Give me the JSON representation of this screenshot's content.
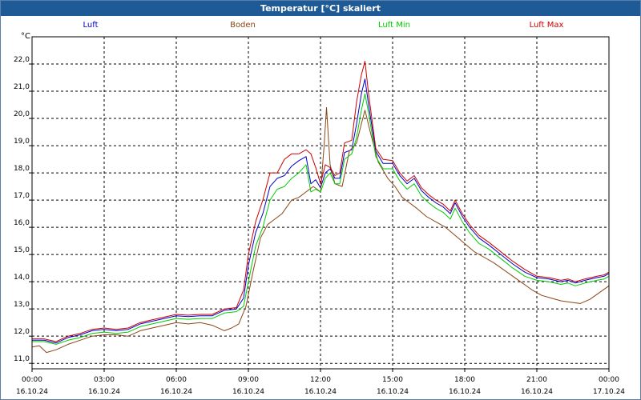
{
  "window": {
    "title": "Temperatur [°C] skaliert"
  },
  "chart_data": {
    "type": "line",
    "title": "Temperatur [°C] skaliert",
    "ylabel": "°C",
    "xlabel": "",
    "ylim": [
      10.8,
      23.0
    ],
    "xlim": [
      0,
      24
    ],
    "yticks": [
      "11,0",
      "12,0",
      "13,0",
      "14,0",
      "15,0",
      "16,0",
      "17,0",
      "18,0",
      "19,0",
      "20,0",
      "21,0",
      "22,0"
    ],
    "xticks": [
      {
        "time": "00:00",
        "date": "16.10.24"
      },
      {
        "time": "03:00",
        "date": "16.10.24"
      },
      {
        "time": "06:00",
        "date": "16.10.24"
      },
      {
        "time": "09:00",
        "date": "16.10.24"
      },
      {
        "time": "12:00",
        "date": "16.10.24"
      },
      {
        "time": "15:00",
        "date": "16.10.24"
      },
      {
        "time": "18:00",
        "date": "16.10.24"
      },
      {
        "time": "21:00",
        "date": "16.10.24"
      },
      {
        "time": "00:00",
        "date": "17.10.24"
      }
    ],
    "grid": true,
    "legend_position": "top",
    "series": [
      {
        "name": "Luft",
        "color": "#0000cc",
        "points": [
          [
            0,
            11.85
          ],
          [
            0.5,
            11.85
          ],
          [
            1,
            11.75
          ],
          [
            1.5,
            11.95
          ],
          [
            2,
            12.05
          ],
          [
            2.5,
            12.2
          ],
          [
            3,
            12.25
          ],
          [
            3.5,
            12.2
          ],
          [
            4,
            12.25
          ],
          [
            4.5,
            12.45
          ],
          [
            5,
            12.55
          ],
          [
            5.5,
            12.65
          ],
          [
            6,
            12.75
          ],
          [
            6.5,
            12.72
          ],
          [
            7,
            12.75
          ],
          [
            7.5,
            12.75
          ],
          [
            8,
            12.95
          ],
          [
            8.5,
            13.0
          ],
          [
            8.8,
            13.4
          ],
          [
            9.0,
            14.6
          ],
          [
            9.3,
            15.8
          ],
          [
            9.6,
            16.5
          ],
          [
            9.9,
            17.5
          ],
          [
            10.2,
            17.8
          ],
          [
            10.5,
            17.9
          ],
          [
            10.8,
            18.25
          ],
          [
            11.1,
            18.45
          ],
          [
            11.4,
            18.6
          ],
          [
            11.6,
            17.6
          ],
          [
            11.8,
            17.75
          ],
          [
            12.0,
            17.45
          ],
          [
            12.2,
            18.0
          ],
          [
            12.4,
            18.15
          ],
          [
            12.6,
            17.8
          ],
          [
            12.8,
            17.8
          ],
          [
            13.0,
            18.75
          ],
          [
            13.3,
            18.85
          ],
          [
            13.5,
            19.8
          ],
          [
            13.7,
            20.9
          ],
          [
            13.85,
            21.45
          ],
          [
            14.0,
            20.5
          ],
          [
            14.3,
            18.8
          ],
          [
            14.6,
            18.35
          ],
          [
            15.0,
            18.35
          ],
          [
            15.3,
            17.9
          ],
          [
            15.6,
            17.6
          ],
          [
            15.9,
            17.8
          ],
          [
            16.2,
            17.35
          ],
          [
            16.5,
            17.1
          ],
          [
            16.8,
            16.9
          ],
          [
            17.1,
            16.75
          ],
          [
            17.4,
            16.5
          ],
          [
            17.6,
            16.9
          ],
          [
            17.9,
            16.4
          ],
          [
            18.2,
            16.0
          ],
          [
            18.6,
            15.6
          ],
          [
            19.0,
            15.35
          ],
          [
            19.5,
            15.0
          ],
          [
            20.0,
            14.65
          ],
          [
            20.5,
            14.35
          ],
          [
            21.0,
            14.15
          ],
          [
            21.5,
            14.1
          ],
          [
            22.0,
            14.0
          ],
          [
            22.3,
            14.05
          ],
          [
            22.6,
            13.95
          ],
          [
            23.0,
            14.05
          ],
          [
            23.5,
            14.15
          ],
          [
            23.8,
            14.2
          ],
          [
            24.0,
            14.3
          ]
        ]
      },
      {
        "name": "Boden",
        "color": "#8b4513",
        "points": [
          [
            0,
            11.6
          ],
          [
            0.3,
            11.65
          ],
          [
            0.6,
            11.4
          ],
          [
            1,
            11.5
          ],
          [
            1.5,
            11.7
          ],
          [
            2,
            11.85
          ],
          [
            2.5,
            12.0
          ],
          [
            3,
            12.05
          ],
          [
            3.5,
            12.05
          ],
          [
            4,
            12.0
          ],
          [
            4.5,
            12.2
          ],
          [
            5,
            12.3
          ],
          [
            5.5,
            12.4
          ],
          [
            6,
            12.5
          ],
          [
            6.5,
            12.45
          ],
          [
            7,
            12.5
          ],
          [
            7.5,
            12.4
          ],
          [
            8,
            12.2
          ],
          [
            8.3,
            12.3
          ],
          [
            8.6,
            12.45
          ],
          [
            8.9,
            13.1
          ],
          [
            9.2,
            14.4
          ],
          [
            9.5,
            15.6
          ],
          [
            9.8,
            16.1
          ],
          [
            10.1,
            16.3
          ],
          [
            10.4,
            16.5
          ],
          [
            10.8,
            17.0
          ],
          [
            11.1,
            17.1
          ],
          [
            11.4,
            17.3
          ],
          [
            11.7,
            17.5
          ],
          [
            12.0,
            17.3
          ],
          [
            12.15,
            19.0
          ],
          [
            12.25,
            20.4
          ],
          [
            12.4,
            18.3
          ],
          [
            12.6,
            17.6
          ],
          [
            12.9,
            17.5
          ],
          [
            13.2,
            18.8
          ],
          [
            13.5,
            19.1
          ],
          [
            13.7,
            19.8
          ],
          [
            13.85,
            20.3
          ],
          [
            14.1,
            19.4
          ],
          [
            14.4,
            18.4
          ],
          [
            14.8,
            17.8
          ],
          [
            15.1,
            17.5
          ],
          [
            15.4,
            17.1
          ],
          [
            15.7,
            16.9
          ],
          [
            16.0,
            16.7
          ],
          [
            16.4,
            16.4
          ],
          [
            16.8,
            16.2
          ],
          [
            17.2,
            16.0
          ],
          [
            17.6,
            15.7
          ],
          [
            18.0,
            15.4
          ],
          [
            18.4,
            15.1
          ],
          [
            18.8,
            14.9
          ],
          [
            19.2,
            14.7
          ],
          [
            19.6,
            14.45
          ],
          [
            20.0,
            14.2
          ],
          [
            20.4,
            13.95
          ],
          [
            20.8,
            13.7
          ],
          [
            21.2,
            13.5
          ],
          [
            21.6,
            13.4
          ],
          [
            22.0,
            13.3
          ],
          [
            22.4,
            13.25
          ],
          [
            22.8,
            13.2
          ],
          [
            23.2,
            13.35
          ],
          [
            23.6,
            13.6
          ],
          [
            24.0,
            13.85
          ]
        ]
      },
      {
        "name": "Luft Min",
        "color": "#00cc00",
        "points": [
          [
            0,
            11.8
          ],
          [
            0.5,
            11.8
          ],
          [
            1,
            11.7
          ],
          [
            1.5,
            11.85
          ],
          [
            2,
            11.95
          ],
          [
            2.5,
            12.1
          ],
          [
            3,
            12.15
          ],
          [
            3.5,
            12.1
          ],
          [
            4,
            12.15
          ],
          [
            4.5,
            12.35
          ],
          [
            5,
            12.45
          ],
          [
            5.5,
            12.55
          ],
          [
            6,
            12.65
          ],
          [
            6.5,
            12.62
          ],
          [
            7,
            12.65
          ],
          [
            7.5,
            12.65
          ],
          [
            8,
            12.85
          ],
          [
            8.5,
            12.9
          ],
          [
            8.8,
            13.1
          ],
          [
            9.0,
            14.0
          ],
          [
            9.3,
            15.3
          ],
          [
            9.6,
            16.0
          ],
          [
            9.9,
            17.0
          ],
          [
            10.2,
            17.4
          ],
          [
            10.5,
            17.5
          ],
          [
            10.8,
            17.8
          ],
          [
            11.1,
            18.0
          ],
          [
            11.4,
            18.3
          ],
          [
            11.6,
            17.3
          ],
          [
            11.8,
            17.4
          ],
          [
            12.0,
            17.3
          ],
          [
            12.2,
            17.8
          ],
          [
            12.4,
            18.0
          ],
          [
            12.6,
            17.6
          ],
          [
            12.8,
            17.6
          ],
          [
            13.0,
            18.5
          ],
          [
            13.3,
            18.7
          ],
          [
            13.5,
            19.3
          ],
          [
            13.7,
            20.3
          ],
          [
            13.85,
            20.9
          ],
          [
            14.0,
            20.2
          ],
          [
            14.3,
            18.6
          ],
          [
            14.6,
            18.15
          ],
          [
            15.0,
            18.15
          ],
          [
            15.3,
            17.7
          ],
          [
            15.6,
            17.4
          ],
          [
            15.9,
            17.6
          ],
          [
            16.2,
            17.15
          ],
          [
            16.5,
            16.9
          ],
          [
            16.8,
            16.7
          ],
          [
            17.1,
            16.55
          ],
          [
            17.4,
            16.3
          ],
          [
            17.6,
            16.7
          ],
          [
            17.9,
            16.2
          ],
          [
            18.2,
            15.8
          ],
          [
            18.6,
            15.4
          ],
          [
            19.0,
            15.2
          ],
          [
            19.5,
            14.85
          ],
          [
            20.0,
            14.5
          ],
          [
            20.5,
            14.2
          ],
          [
            21.0,
            14.05
          ],
          [
            21.5,
            14.0
          ],
          [
            22.0,
            13.9
          ],
          [
            22.3,
            13.95
          ],
          [
            22.6,
            13.85
          ],
          [
            23.0,
            13.95
          ],
          [
            23.5,
            14.05
          ],
          [
            23.8,
            14.1
          ],
          [
            24.0,
            14.2
          ]
        ]
      },
      {
        "name": "Luft Max",
        "color": "#cc0000",
        "points": [
          [
            0,
            11.9
          ],
          [
            0.5,
            11.9
          ],
          [
            1,
            11.8
          ],
          [
            1.5,
            12.0
          ],
          [
            2,
            12.1
          ],
          [
            2.5,
            12.25
          ],
          [
            3,
            12.3
          ],
          [
            3.5,
            12.25
          ],
          [
            4,
            12.3
          ],
          [
            4.5,
            12.5
          ],
          [
            5,
            12.6
          ],
          [
            5.5,
            12.7
          ],
          [
            6,
            12.8
          ],
          [
            6.5,
            12.77
          ],
          [
            7,
            12.8
          ],
          [
            7.5,
            12.8
          ],
          [
            8,
            13.0
          ],
          [
            8.5,
            13.05
          ],
          [
            8.8,
            13.7
          ],
          [
            9.0,
            15.0
          ],
          [
            9.3,
            16.2
          ],
          [
            9.6,
            17.0
          ],
          [
            9.9,
            18.0
          ],
          [
            10.2,
            18.0
          ],
          [
            10.5,
            18.5
          ],
          [
            10.8,
            18.7
          ],
          [
            11.1,
            18.7
          ],
          [
            11.4,
            18.85
          ],
          [
            11.6,
            18.7
          ],
          [
            11.8,
            18.2
          ],
          [
            12.0,
            17.6
          ],
          [
            12.2,
            18.3
          ],
          [
            12.4,
            18.2
          ],
          [
            12.6,
            17.9
          ],
          [
            12.8,
            18.0
          ],
          [
            13.0,
            19.1
          ],
          [
            13.3,
            19.2
          ],
          [
            13.5,
            20.6
          ],
          [
            13.7,
            21.6
          ],
          [
            13.85,
            22.1
          ],
          [
            14.0,
            20.9
          ],
          [
            14.3,
            18.9
          ],
          [
            14.6,
            18.5
          ],
          [
            15.0,
            18.45
          ],
          [
            15.3,
            18.0
          ],
          [
            15.6,
            17.7
          ],
          [
            15.9,
            17.9
          ],
          [
            16.2,
            17.45
          ],
          [
            16.5,
            17.2
          ],
          [
            16.8,
            17.0
          ],
          [
            17.1,
            16.85
          ],
          [
            17.4,
            16.6
          ],
          [
            17.6,
            17.0
          ],
          [
            17.9,
            16.5
          ],
          [
            18.2,
            16.1
          ],
          [
            18.6,
            15.7
          ],
          [
            19.0,
            15.45
          ],
          [
            19.5,
            15.1
          ],
          [
            20.0,
            14.75
          ],
          [
            20.5,
            14.45
          ],
          [
            21.0,
            14.2
          ],
          [
            21.5,
            14.15
          ],
          [
            22.0,
            14.05
          ],
          [
            22.3,
            14.1
          ],
          [
            22.6,
            14.0
          ],
          [
            23.0,
            14.1
          ],
          [
            23.5,
            14.2
          ],
          [
            23.8,
            14.25
          ],
          [
            24.0,
            14.35
          ]
        ]
      }
    ]
  }
}
